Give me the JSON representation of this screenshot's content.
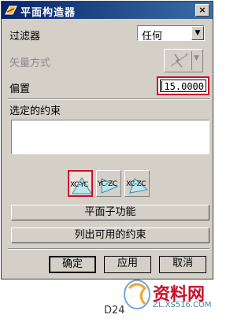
{
  "window": {
    "title": "平面构造器",
    "close_glyph": "×"
  },
  "filter": {
    "label": "过滤器",
    "value": "任何"
  },
  "vector_method": {
    "label": "矢量方式"
  },
  "offset": {
    "label": "偏置",
    "value": "15.0000"
  },
  "constraints": {
    "label": "选定的约束"
  },
  "plane_buttons": [
    {
      "label": "XC-YC",
      "selected": true
    },
    {
      "label": "YC-ZC",
      "selected": false
    },
    {
      "label": "XC-ZC",
      "selected": false
    }
  ],
  "subfunction_button": "平面子功能",
  "list_constraints_button": "列出可用的约束",
  "footer": {
    "ok": "确定",
    "apply": "应用",
    "cancel": "取消"
  },
  "caption": "D24",
  "watermark": {
    "title": "资料网",
    "url": "ZL.XS516.COM"
  },
  "colors": {
    "highlight": "#c8102e",
    "titlebar": "#0a246a",
    "dialog": "#d4d0c8"
  }
}
